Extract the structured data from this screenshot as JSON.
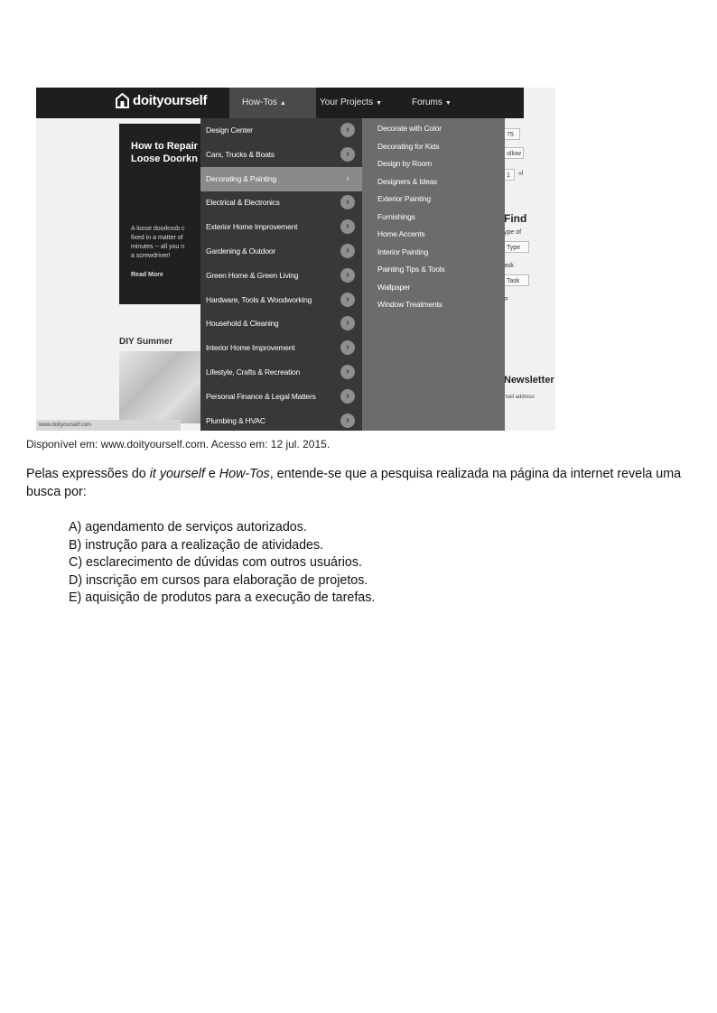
{
  "screenshot": {
    "logo_text": "doityourself",
    "nav": [
      {
        "label": "How-Tos",
        "caret": "▲"
      },
      {
        "label": "Your Projects",
        "caret": "▼"
      },
      {
        "label": "Forums",
        "caret": "▼"
      }
    ],
    "hero": {
      "title": "How to Repair\nLoose Doorkn",
      "text": "A loose doorknob c\nfixed in a matter of\nminutes -- all you n\na screwdriver!",
      "read_more": "Read More"
    },
    "section_label": "DIY Summer",
    "url": "www.doityourself.com",
    "right_strip": {
      "find": "Find",
      "type_lines": [
        "ype of",
        "Type",
        "ask",
        "Task",
        "P"
      ],
      "newsletter": "Newsletter",
      "email": "mail address",
      "top_bits": [
        "75",
        "ollow",
        "1",
        "«l"
      ]
    },
    "menu_level1": [
      "Design Center",
      "Cars, Trucks & Boats",
      "Decorating & Painting",
      "Electrical & Electronics",
      "Exterior Home Improvement",
      "Gardening & Outdoor",
      "Green Home & Green Living",
      "Hardware, Tools & Woodworking",
      "Household & Cleaning",
      "Interior Home Improvement",
      "Lifestyle, Crafts & Recreation",
      "Personal Finance & Legal Matters",
      "Plumbing & HVAC"
    ],
    "menu_level1_active_index": 2,
    "menu_level2": [
      "Decorate with Color",
      "Decorating for Kids",
      "Design by Room",
      "Designers & Ideas",
      "Exterior Painting",
      "Furnishings",
      "Home Accents",
      "Interior Painting",
      "Painting Tips & Tools",
      "Wallpaper",
      "Window Treatments"
    ]
  },
  "caption": "Disponível em: www.doityourself.com. Acesso em: 12 jul. 2015.",
  "stem": {
    "part1": "Pelas expressões do ",
    "italic1": "it yourself",
    "part2": " e ",
    "italic2": "How-Tos",
    "part3": ", entende-se que a pesquisa realizada na página da internet revela uma busca por:"
  },
  "options": [
    "A) agendamento de serviços autorizados.",
    "B) instrução para a realização de atividades.",
    "C) esclarecimento de dúvidas com outros usuários.",
    "D) inscrição em cursos para elaboração de projetos.",
    "E) aquisição de produtos para a execução de tarefas."
  ]
}
